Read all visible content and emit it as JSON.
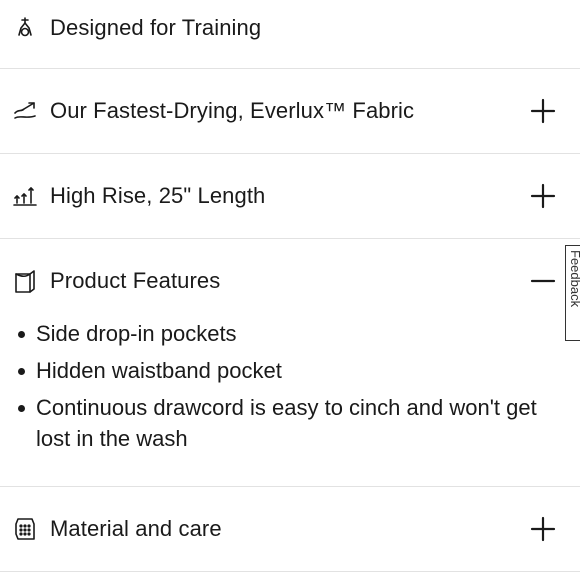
{
  "sections": [
    {
      "label": "Designed for Training",
      "icon": "training-icon"
    },
    {
      "label": "Our Fastest-Drying, Everlux™ Fabric",
      "icon": "fast-drying-icon",
      "toggle": "+"
    },
    {
      "label": "High Rise, 25\" Length",
      "icon": "rise-length-icon",
      "toggle": "+"
    },
    {
      "label": "Product Features",
      "icon": "product-features-icon",
      "toggle": "−",
      "items": [
        "Side drop-in pockets",
        "Hidden waistband pocket",
        "Continuous drawcord is easy to cinch and won't get lost in the wash"
      ]
    },
    {
      "label": "Material and care",
      "icon": "material-care-icon",
      "toggle": "+"
    }
  ],
  "feedback_tab": {
    "label": "Feedback"
  }
}
